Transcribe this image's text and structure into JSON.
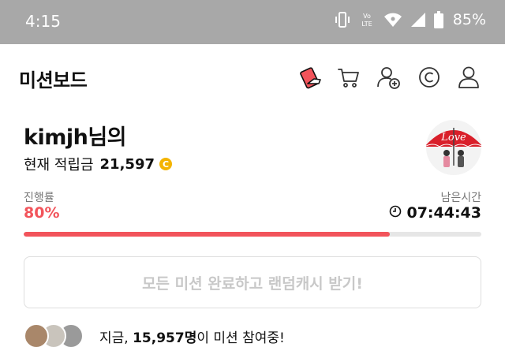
{
  "status_bar": {
    "time": "4:15",
    "volte": "Vo LTE",
    "battery": "85%"
  },
  "header": {
    "title": "미션보드",
    "icons": [
      "mission-card-icon",
      "cart-icon",
      "add-user-icon",
      "coin-icon",
      "profile-icon"
    ]
  },
  "user": {
    "name": "kimjh님의",
    "points_label": "현재 적립금",
    "points_value": "21,597",
    "coin_symbol": "C",
    "avatar_text": "Love"
  },
  "progress": {
    "label": "진행률",
    "percent_text": "80%",
    "fraction": 0.8,
    "remaining_label": "남은시간",
    "remaining_time": "07:44:43"
  },
  "reward_button": {
    "label": "모든 미션 완료하고 랜덤캐시 받기!"
  },
  "participants": {
    "prefix": "지금, ",
    "count": "15,957명",
    "suffix": "이 미션 참여중!"
  },
  "colors": {
    "accent": "#f2545b",
    "coin": "#f4b400",
    "status_bar": "#a8a8a8"
  }
}
